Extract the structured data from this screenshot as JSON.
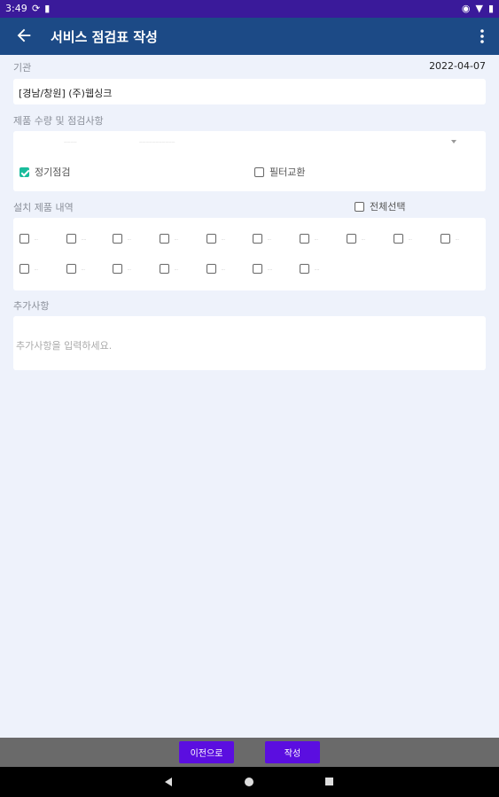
{
  "status_bar": {
    "time": "3:49"
  },
  "app_bar": {
    "title": "서비스 점검표 작성"
  },
  "period": {
    "label": "기관",
    "date": "2022-04-07"
  },
  "institution": {
    "value": "[경남/창원] (주)웹싱크"
  },
  "inspection": {
    "label": "제품 수량 및 점검사항",
    "faint_left": "ᅳᅳᅳᅳ",
    "faint_mid": "ᅳᅳᅳᅳᅳᅳᅳᅳᅳᅳᅳ",
    "dropdown_icon": "caret-down",
    "options": [
      {
        "label": "정기점검",
        "checked": true
      },
      {
        "label": "필터교환",
        "checked": false
      }
    ]
  },
  "installed": {
    "label": "설치 제품 내역",
    "select_all": "전체선택",
    "items": [
      {
        "label": "..."
      },
      {
        "label": "...."
      },
      {
        "label": "..."
      },
      {
        "label": "..."
      },
      {
        "label": "..."
      },
      {
        "label": "..."
      },
      {
        "label": "..."
      },
      {
        "label": "..."
      },
      {
        "label": "..."
      },
      {
        "label": "..."
      },
      {
        "label": "..."
      },
      {
        "label": "..."
      },
      {
        "label": "..."
      },
      {
        "label": "..."
      },
      {
        "label": "..."
      },
      {
        "label": "...."
      },
      {
        "label": "...."
      }
    ]
  },
  "additional": {
    "label": "추가사항",
    "placeholder": "추가사항을 입력하세요."
  },
  "buttons": {
    "prev": "이전으로",
    "submit": "작성"
  },
  "colors": {
    "status_bar": "#3a1a9a",
    "app_bar": "#1c4a86",
    "accent": "#1abc9c",
    "button": "#5b0ee0"
  }
}
